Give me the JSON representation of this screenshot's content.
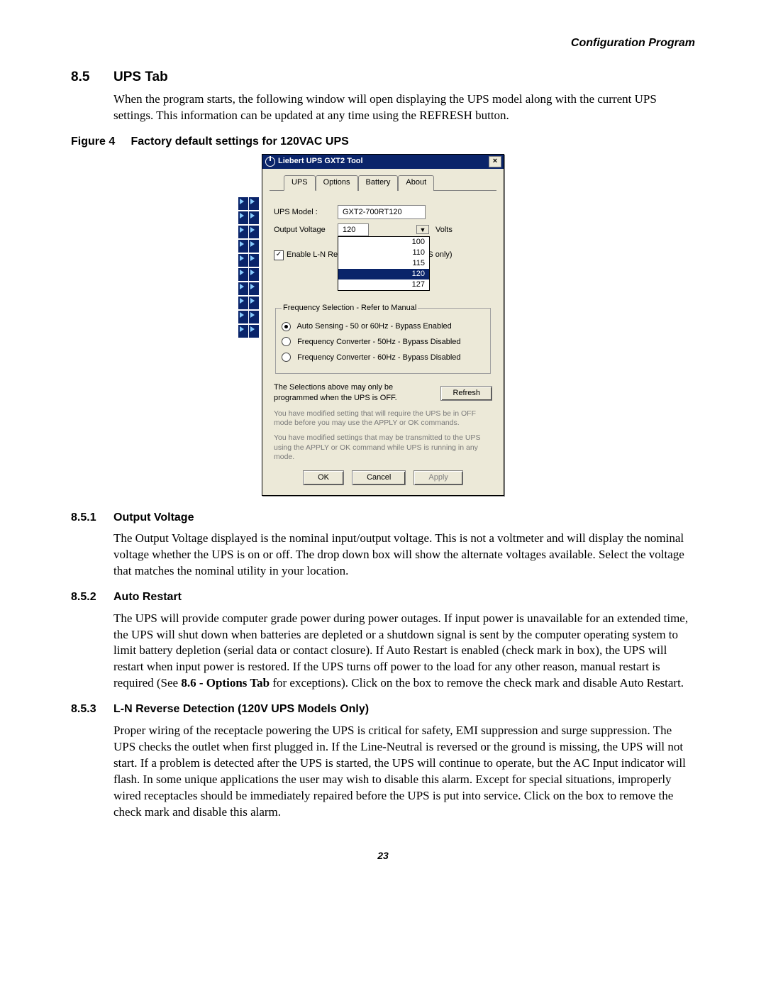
{
  "header": {
    "right": "Configuration Program"
  },
  "s85": {
    "num": "8.5",
    "title": "UPS Tab",
    "para": "When the program starts, the following window will open displaying the UPS model along with the current UPS settings. This information can be updated at any time using the REFRESH button."
  },
  "fig4": {
    "label": "Figure 4",
    "caption": "Factory default settings for 120VAC UPS"
  },
  "dialog": {
    "title": "Liebert UPS GXT2 Tool",
    "tabs": [
      "UPS",
      "Options",
      "Battery",
      "About"
    ],
    "ups_model_label": "UPS Model :",
    "ups_model_value": "GXT2-700RT120",
    "output_voltage_label": "Output Voltage",
    "output_voltage_value": "120",
    "volts_suffix": "Volts",
    "voltage_options": [
      "100",
      "110",
      "115",
      "120",
      "127"
    ],
    "voltage_selected_index": 3,
    "enable_ln_label": "Enable L-N Reverse Detection (120V UPS only)",
    "enable_ln_checked": true,
    "freq_legend": "Frequency Selection - Refer to Manual",
    "freq_opts": [
      "Auto Sensing - 50 or 60Hz - Bypass Enabled",
      "Frequency Converter - 50Hz - Bypass Disabled",
      "Frequency Converter - 60Hz - Bypass Disabled"
    ],
    "freq_selected": 0,
    "note1a": "The Selections above may only be",
    "note1b": "programmed when the UPS is OFF.",
    "refresh": "Refresh",
    "msg1": "You have modified setting that will require the UPS be in OFF mode before you may use the APPLY or OK commands.",
    "msg2": "You have modified settings that may be transmitted to the UPS using the APPLY or OK command while UPS is running in any mode.",
    "ok": "OK",
    "cancel": "Cancel",
    "apply": "Apply"
  },
  "s851": {
    "num": "8.5.1",
    "title": "Output Voltage",
    "para": "The Output Voltage displayed is the nominal input/output voltage. This is not a voltmeter and will display the nominal voltage whether the UPS is on or off. The drop down box will show the alternate voltages available. Select the voltage that matches the nominal utility in your location."
  },
  "s852": {
    "num": "8.5.2",
    "title": "Auto Restart",
    "para_a": "The UPS will provide computer grade power during power outages. If input power is unavailable for an extended time, the UPS will shut down when batteries are depleted or a shutdown signal is sent by the computer operating system to limit battery depletion (serial data or contact closure). If Auto Restart is enabled (check mark in box), the UPS will restart when input power is restored. If the UPS turns off power to the load for any other reason, manual restart is required (See ",
    "para_b": "8.6 - Options Tab",
    "para_c": " for exceptions). Click on the box to remove the check mark and disable Auto Restart."
  },
  "s853": {
    "num": "8.5.3",
    "title": "L-N Reverse Detection (120V UPS Models Only)",
    "para": "Proper wiring of the receptacle powering the UPS is critical for safety, EMI suppression and surge suppression. The UPS checks the outlet when first plugged in. If the Line-Neutral is reversed or the ground is missing, the UPS will not start. If a problem is detected after the UPS is started, the UPS will continue to operate, but the AC Input indicator will flash. In some unique applications the user may wish to disable this alarm. Except for special situations, improperly wired receptacles should be immediately repaired before the UPS is put into service. Click on the box to remove the check mark and disable this alarm."
  },
  "pagenum": "23"
}
